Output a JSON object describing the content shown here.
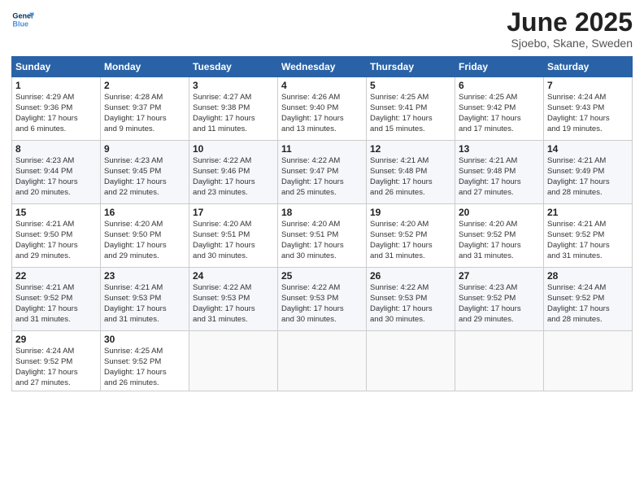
{
  "header": {
    "logo_line1": "General",
    "logo_line2": "Blue",
    "title": "June 2025",
    "subtitle": "Sjoebo, Skane, Sweden"
  },
  "columns": [
    "Sunday",
    "Monday",
    "Tuesday",
    "Wednesday",
    "Thursday",
    "Friday",
    "Saturday"
  ],
  "weeks": [
    [
      {
        "day": "1",
        "sunrise": "4:29 AM",
        "sunset": "9:36 PM",
        "daylight": "17 hours and 6 minutes."
      },
      {
        "day": "2",
        "sunrise": "4:28 AM",
        "sunset": "9:37 PM",
        "daylight": "17 hours and 9 minutes."
      },
      {
        "day": "3",
        "sunrise": "4:27 AM",
        "sunset": "9:38 PM",
        "daylight": "17 hours and 11 minutes."
      },
      {
        "day": "4",
        "sunrise": "4:26 AM",
        "sunset": "9:40 PM",
        "daylight": "17 hours and 13 minutes."
      },
      {
        "day": "5",
        "sunrise": "4:25 AM",
        "sunset": "9:41 PM",
        "daylight": "17 hours and 15 minutes."
      },
      {
        "day": "6",
        "sunrise": "4:25 AM",
        "sunset": "9:42 PM",
        "daylight": "17 hours and 17 minutes."
      },
      {
        "day": "7",
        "sunrise": "4:24 AM",
        "sunset": "9:43 PM",
        "daylight": "17 hours and 19 minutes."
      }
    ],
    [
      {
        "day": "8",
        "sunrise": "4:23 AM",
        "sunset": "9:44 PM",
        "daylight": "17 hours and 20 minutes."
      },
      {
        "day": "9",
        "sunrise": "4:23 AM",
        "sunset": "9:45 PM",
        "daylight": "17 hours and 22 minutes."
      },
      {
        "day": "10",
        "sunrise": "4:22 AM",
        "sunset": "9:46 PM",
        "daylight": "17 hours and 23 minutes."
      },
      {
        "day": "11",
        "sunrise": "4:22 AM",
        "sunset": "9:47 PM",
        "daylight": "17 hours and 25 minutes."
      },
      {
        "day": "12",
        "sunrise": "4:21 AM",
        "sunset": "9:48 PM",
        "daylight": "17 hours and 26 minutes."
      },
      {
        "day": "13",
        "sunrise": "4:21 AM",
        "sunset": "9:48 PM",
        "daylight": "17 hours and 27 minutes."
      },
      {
        "day": "14",
        "sunrise": "4:21 AM",
        "sunset": "9:49 PM",
        "daylight": "17 hours and 28 minutes."
      }
    ],
    [
      {
        "day": "15",
        "sunrise": "4:21 AM",
        "sunset": "9:50 PM",
        "daylight": "17 hours and 29 minutes."
      },
      {
        "day": "16",
        "sunrise": "4:20 AM",
        "sunset": "9:50 PM",
        "daylight": "17 hours and 29 minutes."
      },
      {
        "day": "17",
        "sunrise": "4:20 AM",
        "sunset": "9:51 PM",
        "daylight": "17 hours and 30 minutes."
      },
      {
        "day": "18",
        "sunrise": "4:20 AM",
        "sunset": "9:51 PM",
        "daylight": "17 hours and 30 minutes."
      },
      {
        "day": "19",
        "sunrise": "4:20 AM",
        "sunset": "9:52 PM",
        "daylight": "17 hours and 31 minutes."
      },
      {
        "day": "20",
        "sunrise": "4:20 AM",
        "sunset": "9:52 PM",
        "daylight": "17 hours and 31 minutes."
      },
      {
        "day": "21",
        "sunrise": "4:21 AM",
        "sunset": "9:52 PM",
        "daylight": "17 hours and 31 minutes."
      }
    ],
    [
      {
        "day": "22",
        "sunrise": "4:21 AM",
        "sunset": "9:52 PM",
        "daylight": "17 hours and 31 minutes."
      },
      {
        "day": "23",
        "sunrise": "4:21 AM",
        "sunset": "9:53 PM",
        "daylight": "17 hours and 31 minutes."
      },
      {
        "day": "24",
        "sunrise": "4:22 AM",
        "sunset": "9:53 PM",
        "daylight": "17 hours and 31 minutes."
      },
      {
        "day": "25",
        "sunrise": "4:22 AM",
        "sunset": "9:53 PM",
        "daylight": "17 hours and 30 minutes."
      },
      {
        "day": "26",
        "sunrise": "4:22 AM",
        "sunset": "9:53 PM",
        "daylight": "17 hours and 30 minutes."
      },
      {
        "day": "27",
        "sunrise": "4:23 AM",
        "sunset": "9:52 PM",
        "daylight": "17 hours and 29 minutes."
      },
      {
        "day": "28",
        "sunrise": "4:24 AM",
        "sunset": "9:52 PM",
        "daylight": "17 hours and 28 minutes."
      }
    ],
    [
      {
        "day": "29",
        "sunrise": "4:24 AM",
        "sunset": "9:52 PM",
        "daylight": "17 hours and 27 minutes."
      },
      {
        "day": "30",
        "sunrise": "4:25 AM",
        "sunset": "9:52 PM",
        "daylight": "17 hours and 26 minutes."
      },
      null,
      null,
      null,
      null,
      null
    ]
  ],
  "labels": {
    "sunrise": "Sunrise:",
    "sunset": "Sunset:",
    "daylight": "Daylight:"
  }
}
